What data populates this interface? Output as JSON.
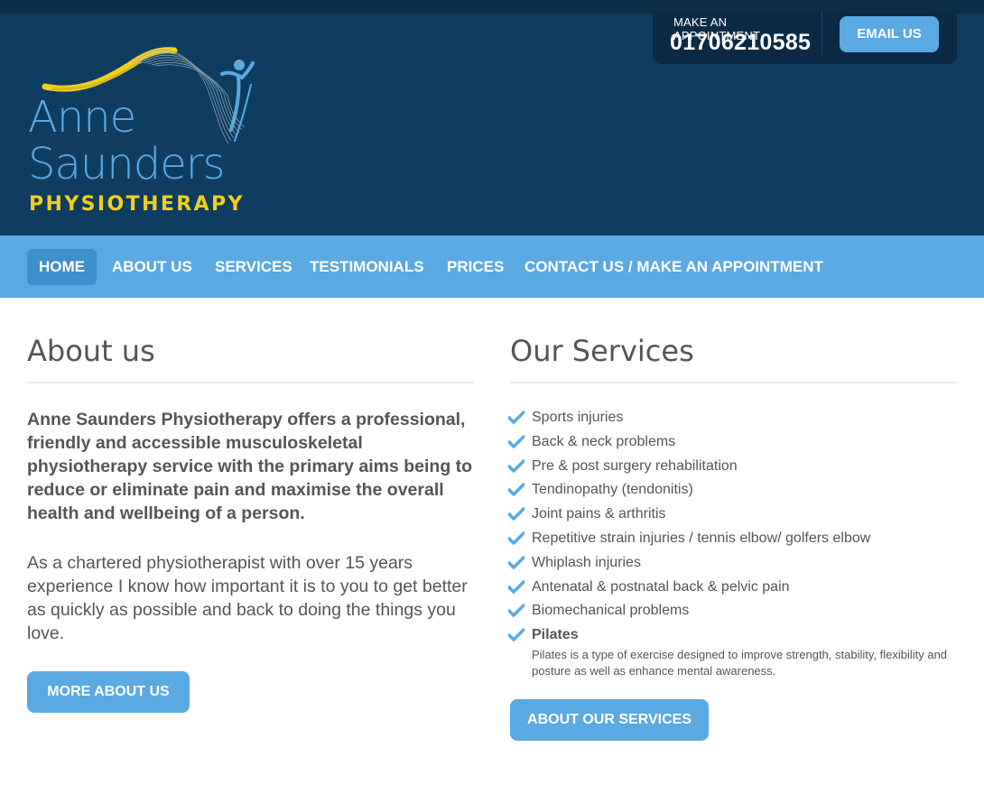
{
  "header": {
    "brand": {
      "line1": "Anne",
      "line2": "Saunders",
      "line3": "PHYSIOTHERAPY"
    },
    "appointment_label": "MAKE AN APPOINTMENT",
    "phone": "01706210585",
    "email_button": "EMAIL US"
  },
  "nav": {
    "items": [
      {
        "label": "HOME",
        "active": true
      },
      {
        "label": "ABOUT US"
      },
      {
        "label": "SERVICES"
      },
      {
        "label": "TESTIMONIALS"
      },
      {
        "label": "PRICES"
      },
      {
        "label": "CONTACT US / MAKE AN APPOINTMENT"
      }
    ]
  },
  "about": {
    "heading": "About us",
    "lead": "Anne Saunders Physiotherapy offers a professional, friendly and accessible musculoskeletal physiotherapy service with the primary aims being to reduce or eliminate pain and maximise the overall health and wellbeing of a person.",
    "body": "As a chartered physiotherapist with over 15 years experience I know how important it is to you to get better as quickly as possible and back to doing the things you love.",
    "button": "MORE ABOUT US"
  },
  "services": {
    "heading": "Our Services",
    "items": [
      "Sports injuries",
      "Back & neck problems",
      "Pre & post surgery rehabilitation",
      "Tendinopathy (tendonitis)",
      "Joint pains & arthritis",
      "Repetitive strain injuries / tennis elbow/ golfers elbow",
      "Whiplash injuries",
      "Antenatal & postnatal back & pelvic pain",
      "Biomechanical problems"
    ],
    "pilates_title": "Pilates",
    "pilates_desc": "Pilates is a type of exercise designed to improve strength, stability, flexibility and posture as well as enhance mental awareness.",
    "button": "ABOUT OUR SERVICES"
  },
  "colors": {
    "header_bg": "#0f3d60",
    "accent": "#5aa9e2",
    "brand_yellow": "#f2cf1c",
    "text": "#555555"
  },
  "icons": {
    "service_bullet": "check-icon"
  }
}
